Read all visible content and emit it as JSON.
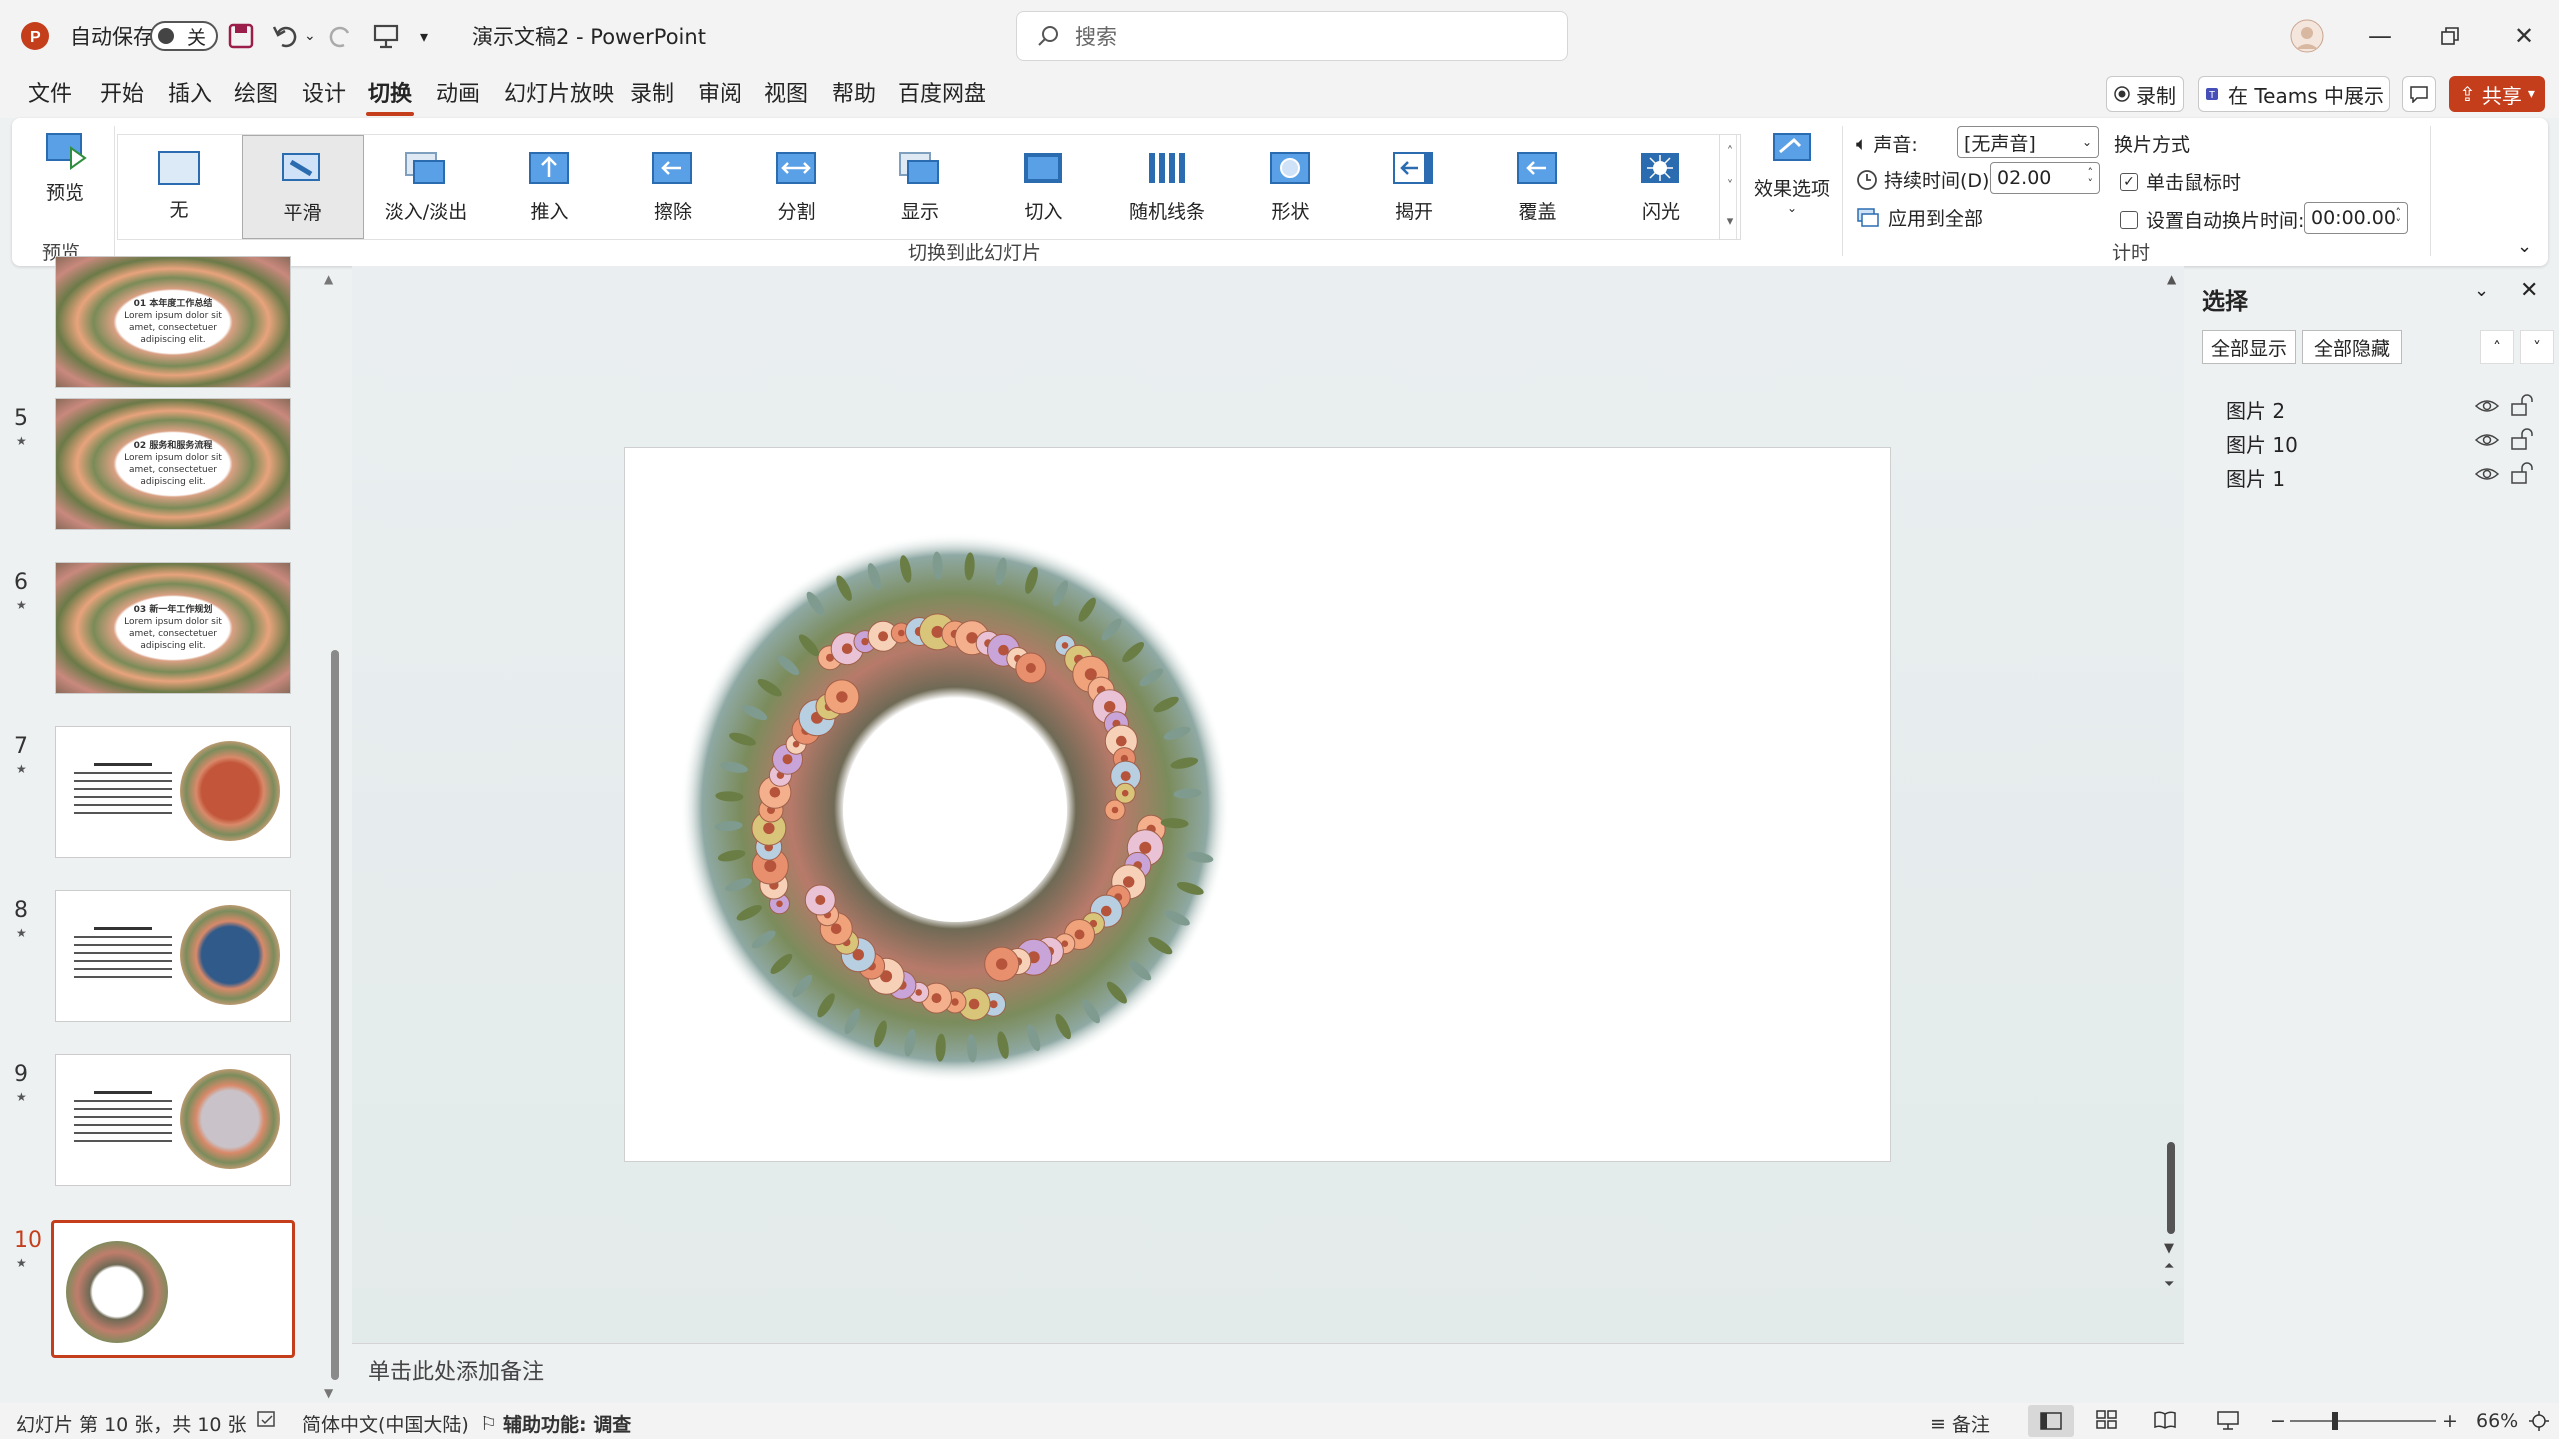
{
  "titlebar": {
    "autosave_label": "自动保存",
    "autosave_state": "关",
    "doc_title": "演示文稿2 - PowerPoint",
    "search_placeholder": "搜索"
  },
  "menu": {
    "tabs": [
      "文件",
      "开始",
      "插入",
      "绘图",
      "设计",
      "切换",
      "动画",
      "幻灯片放映",
      "录制",
      "审阅",
      "视图",
      "帮助",
      "百度网盘"
    ],
    "active_tab": "切换",
    "record_label": "录制",
    "teams_label": "在 Teams 中展示",
    "share_label": "共享",
    "accent_color": "#c43e1c"
  },
  "ribbon": {
    "preview_label": "预览",
    "preview_group": "预览",
    "transitions": [
      "无",
      "平滑",
      "淡入/淡出",
      "推入",
      "擦除",
      "分割",
      "显示",
      "切入",
      "随机线条",
      "形状",
      "揭开",
      "覆盖",
      "闪光"
    ],
    "selected_transition": "平滑",
    "effect_options": "效果选项",
    "transition_group": "切换到此幻灯片",
    "sound_label": "声音:",
    "sound_value": "[无声音]",
    "duration_label": "持续时间(D):",
    "duration_value": "02.00",
    "apply_all": "应用到全部",
    "advance_title": "换片方式",
    "on_click": "单击鼠标时",
    "on_click_checked": true,
    "auto_after": "设置自动换片时间:",
    "auto_after_value": "00:00.00",
    "auto_after_checked": false,
    "timing_group": "计时"
  },
  "thumbnails": [
    {
      "num": "",
      "title": "01 本年度工作总结",
      "body": "Lorem ipsum dolor sit amet, consectetuer adipiscing elit.",
      "kind": "frame"
    },
    {
      "num": "5",
      "title": "02 服务和服务流程",
      "body": "Lorem ipsum dolor sit amet, consectetuer adipiscing elit.",
      "kind": "frame"
    },
    {
      "num": "6",
      "title": "03 新一年工作规划",
      "body": "Lorem ipsum dolor sit amet, consectetuer adipiscing elit.",
      "kind": "frame"
    },
    {
      "num": "7",
      "kind": "text-wreath",
      "accent": "#c2553a"
    },
    {
      "num": "8",
      "kind": "text-wreath",
      "accent": "#2f5a8a"
    },
    {
      "num": "9",
      "kind": "text-wreath",
      "accent": "#c9c3c9"
    },
    {
      "num": "10",
      "kind": "wreath-only",
      "selected": true
    }
  ],
  "notes_placeholder": "单击此处添加备注",
  "selection_pane": {
    "title": "选择",
    "show_all": "全部显示",
    "hide_all": "全部隐藏",
    "items": [
      "图片 2",
      "图片 10",
      "图片 1"
    ]
  },
  "status": {
    "slide_info": "幻灯片 第 10 张，共 10 张",
    "language": "简体中文(中国大陆)",
    "accessibility": "辅助功能: 调查",
    "notes": "备注",
    "zoom": "66%"
  }
}
